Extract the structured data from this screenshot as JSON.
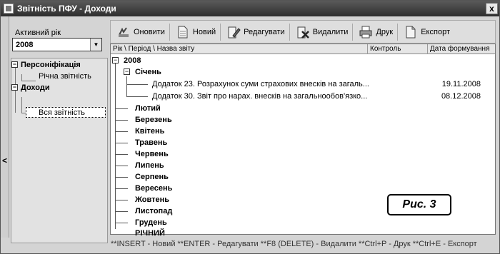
{
  "window": {
    "title": "Звітність ПФУ - Доходи",
    "close_glyph": "x"
  },
  "left_panel": {
    "year_label": "Активний рік",
    "year_value": "2008",
    "collapse_glyph": "<",
    "nav": [
      {
        "label": "Персоніфікація",
        "toggle": "−"
      },
      {
        "label": "Річна звітність"
      },
      {
        "label": "Доходи",
        "toggle": "−"
      },
      {
        "label": "Вся звітність"
      }
    ]
  },
  "toolbar": {
    "buttons": [
      {
        "label": "Оновити",
        "icon": "refresh-icon"
      },
      {
        "label": "Новий",
        "icon": "new-document-icon"
      },
      {
        "label": "Редагувати",
        "icon": "edit-icon"
      },
      {
        "label": "Видалити",
        "icon": "delete-icon"
      },
      {
        "label": "Друк",
        "icon": "printer-icon"
      },
      {
        "label": "Експорт",
        "icon": "export-icon"
      }
    ]
  },
  "grid": {
    "columns": [
      "Рік \\ Період \\ Назва звіту",
      "Контроль",
      "Дата формування"
    ],
    "year": "2008",
    "january": "Січень",
    "reports": [
      {
        "name": "Додаток 23. Розрахунок суми страхових внесків на загаль...",
        "date": "19.11.2008"
      },
      {
        "name": "Додаток 30. Звіт про нарах. внесків на загальнообов'язко...",
        "date": "08.12.2008"
      }
    ],
    "months": [
      "Лютий",
      "Березень",
      "Квітень",
      "Травень",
      "Червень",
      "Липень",
      "Серпень",
      "Вересень",
      "Жовтень",
      "Листопад",
      "Грудень",
      "РІЧНИЙ"
    ]
  },
  "figure_label": "Рис. 3",
  "status_bar": "**INSERT - Новий  **ENTER - Редагувати  **F8 (DELETE) - Видалити  **Ctrl+P - Друк  **Ctrl+E - Експорт"
}
